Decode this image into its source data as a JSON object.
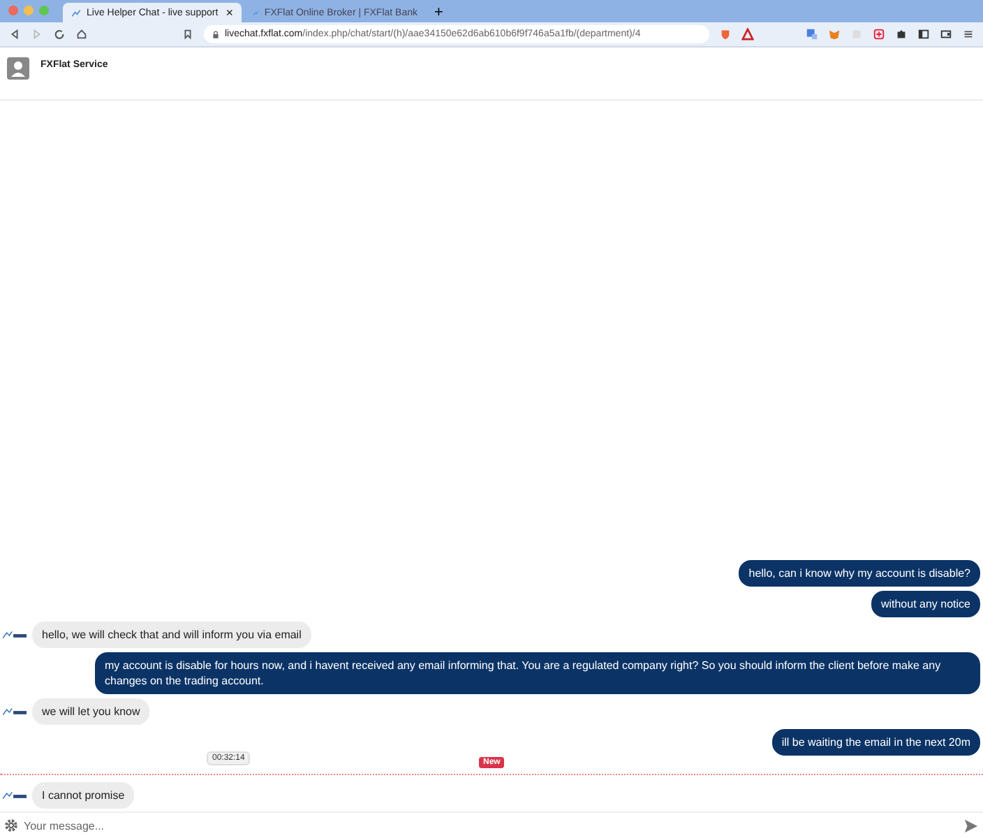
{
  "browser": {
    "tabs": [
      {
        "label": "Live Helper Chat - live support",
        "selected": true,
        "close": "×"
      },
      {
        "label": "FXFlat Online Broker | FXFlat Bank",
        "selected": false
      }
    ],
    "new_tab": "+",
    "url_host": "livechat.fxflat.com",
    "url_path": "/index.php/chat/start/(h)/aae34150e62d6ab610b6f9f746a5a1fb/(department)/4"
  },
  "header": {
    "title": "FXFlat Service"
  },
  "messages": [
    {
      "kind": "visitor",
      "text": "hello, can i know why my account is disable?"
    },
    {
      "kind": "visitor",
      "text": "without any notice"
    },
    {
      "kind": "agent",
      "text": "hello, we will check that and will inform you via email"
    },
    {
      "kind": "visitor",
      "text": "my account is disable for hours now, and i havent received any email informing that. You are a regulated company right? So you should inform the client before make any changes on the trading account."
    },
    {
      "kind": "agent",
      "text": "we will let you know"
    },
    {
      "kind": "visitor",
      "text": "ill be waiting the email in the next 20m"
    },
    {
      "kind": "divider",
      "time": "00:32:14",
      "badge": "New"
    },
    {
      "kind": "agent",
      "text": "I cannot promise"
    }
  ],
  "composer": {
    "placeholder": "Your message..."
  }
}
